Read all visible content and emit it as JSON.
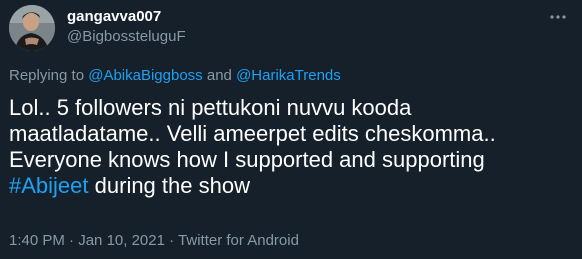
{
  "user": {
    "display_name": "gangavva007",
    "handle": "@BigbossteluguF"
  },
  "more_icon": "more-dots-icon",
  "replying": {
    "prefix": "Replying to",
    "mention_1": "@AbikaBiggboss",
    "conjunction": "and",
    "mention_2": "@HarikaTrends"
  },
  "tweet": {
    "line_1": "Lol.. 5 followers ni pettukoni nuvvu kooda",
    "line_2": "maatladatame.. Velli ameerpet edits cheskomma..",
    "line_3": "Everyone knows how I supported and supporting",
    "hashtag": "#Abijeet",
    "line_4_rest": "during the show"
  },
  "meta": {
    "time": "1:40 PM",
    "separator_1": "·",
    "date": "Jan 10, 2021",
    "separator_2": "·",
    "source": "Twitter for Android"
  },
  "colors": {
    "background": "#15202b",
    "link": "#1da1f2",
    "secondary_text": "#8899a6",
    "primary_text": "#ffffff"
  }
}
